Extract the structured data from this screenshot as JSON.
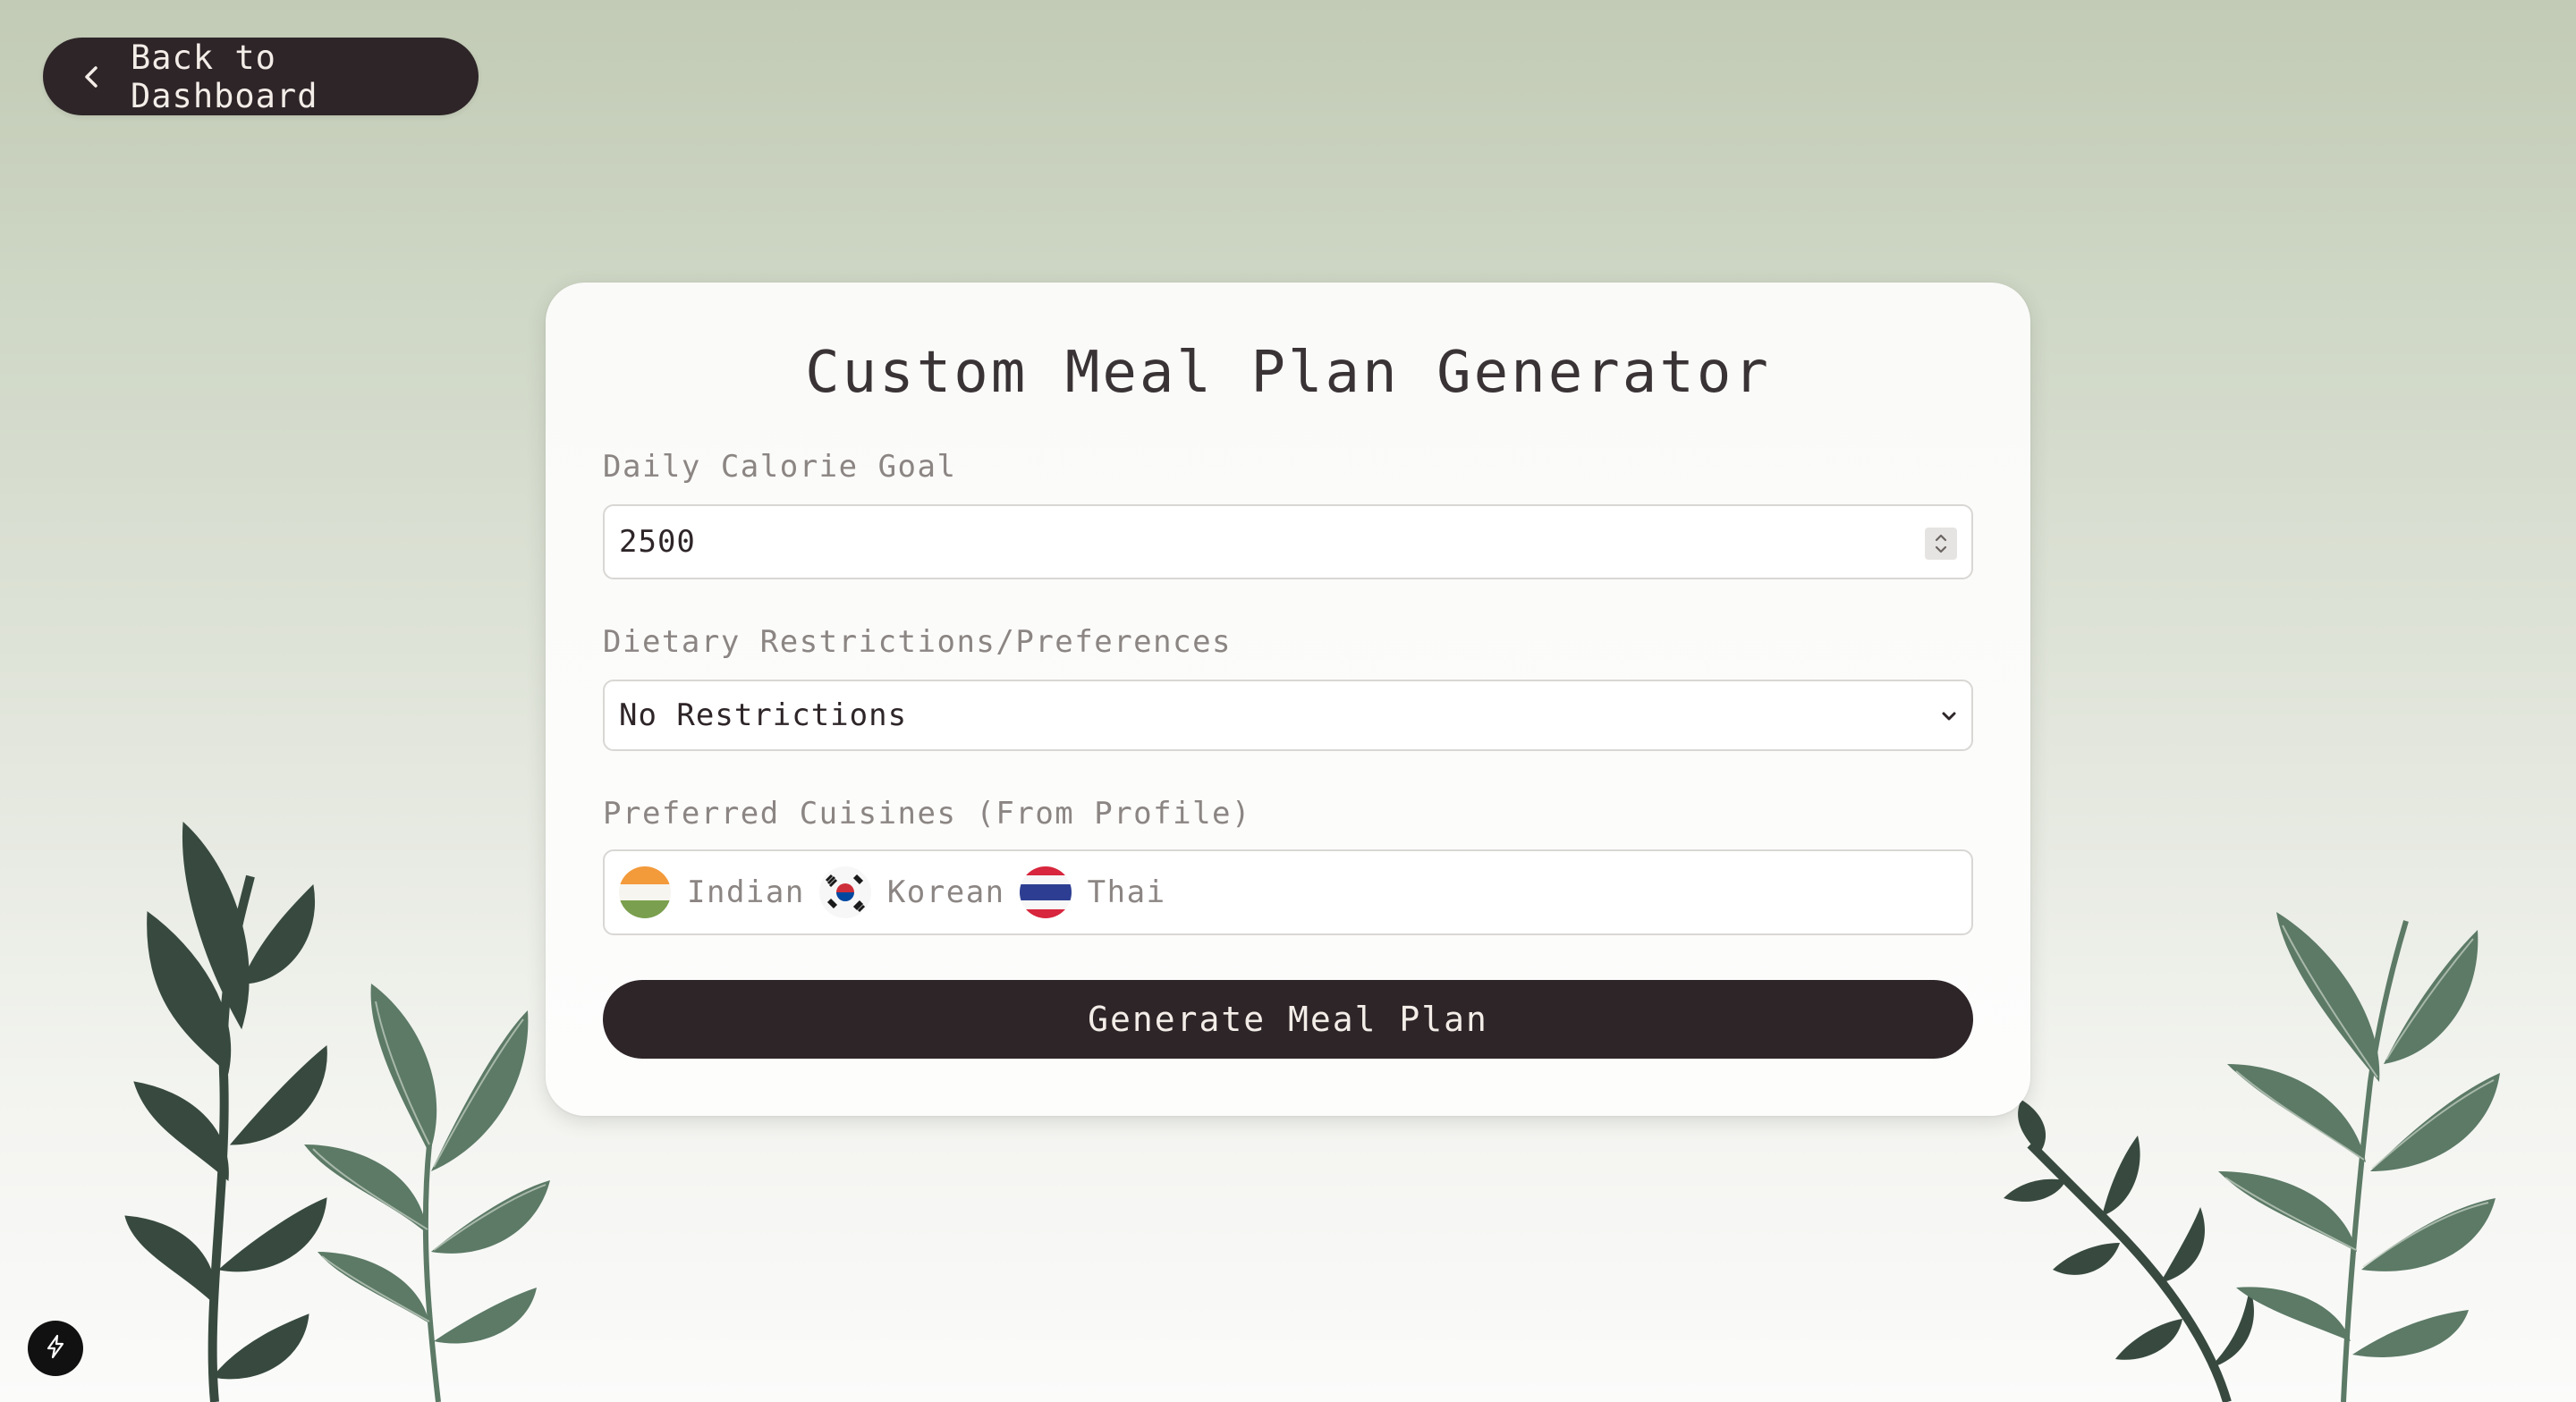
{
  "back_button": {
    "label": "Back to Dashboard",
    "icon": "chevron-left-icon"
  },
  "form": {
    "title": "Custom Meal Plan Generator",
    "calorie": {
      "label": "Daily Calorie Goal",
      "value": "2500"
    },
    "dietary": {
      "label": "Dietary Restrictions/Preferences",
      "selected": "No Restrictions"
    },
    "cuisines": {
      "label": "Preferred Cuisines (From Profile)",
      "items": [
        {
          "name": "Indian",
          "icon": "india-flag-icon"
        },
        {
          "name": "Korean",
          "icon": "south-korea-flag-icon"
        },
        {
          "name": "Thai",
          "icon": "thailand-flag-icon"
        }
      ]
    },
    "submit_label": "Generate Meal Plan"
  },
  "dev_badge": {
    "icon": "lightning-icon"
  },
  "colors": {
    "primary": "#2e2528",
    "button_text": "#f3ede8",
    "muted_text": "#8b8583",
    "leaf_dark": "#384a40",
    "leaf_light": "#5c7a66"
  }
}
